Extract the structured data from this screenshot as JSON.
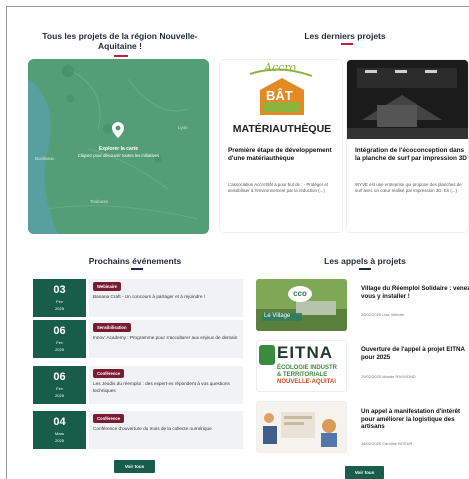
{
  "sections": {
    "projects_map": {
      "title": "Tous les projets de la région Nouvelle-Aquitaine !"
    },
    "latest_projects": {
      "title": "Les derniers projets"
    },
    "events": {
      "title": "Prochains événements"
    },
    "calls": {
      "title": "Les appels à projets"
    }
  },
  "map": {
    "cta_title": "Explorer la carte",
    "cta_subtitle": "Cliquez pour découvrir toutes les initiatives",
    "place_labels": [
      "Bordeaux",
      "Toulouse",
      "Lyon"
    ]
  },
  "projects": [
    {
      "logo_script": "Accro",
      "logo_main": "BÂT",
      "logo_text": "MATÉRIAUTHÈQUE",
      "title": "Première étape de développement d'une matériauthèque",
      "desc": "L'association Accro'Bât a pour but de : - Protéger et sensibiliser à l'environnement par la réduction (...)"
    },
    {
      "title": "Intégration de l'écoconception dans la planche de surf par impression 3D",
      "desc": "WYVE est une entreprise qui propose des planches de surf avec un cœur réalisé par impression 3D. En (...)"
    }
  ],
  "events": [
    {
      "day": "03",
      "month": "Fev",
      "year": "2025",
      "badge": "Webinaire",
      "text": "Banana Craft - Un concours à partager et à rejoindre !"
    },
    {
      "day": "06",
      "month": "Fev",
      "year": "2025",
      "badge": "Sensibilisation",
      "text": "Innov' Academy : Programme pour s'acculturer aux enjeux de demain"
    },
    {
      "day": "06",
      "month": "Fev",
      "year": "2025",
      "badge": "Conférence",
      "text": "Les Jeudis du réemploi : des expert·es répondent à vos questions techniques"
    },
    {
      "day": "04",
      "month": "Mars",
      "year": "2025",
      "badge": "Conférence",
      "text": "Conférence d'ouverture du mois de la collecte numérique"
    }
  ],
  "events_button": "Voir tous",
  "calls": [
    {
      "title": "Village du Réemploi Solidaire : venez vous y installer !",
      "meta": "28/02/2025 Lisa Vetterle",
      "img_logo": "cco",
      "img_caption": "Le Village"
    },
    {
      "title": "Ouverture de l'appel à projet EITNA pour 2025",
      "meta": "29/02/2025 Maude RAYMOND",
      "img_logo": "EITNA",
      "img_sub1": "ÉCOLOGIE INDUSTR",
      "img_sub2": "& TERRITORIALE",
      "img_sub3": "NOUVELLE-AQUITAI"
    },
    {
      "title": "Un appel à manifestation d'intérêt pour améliorer la logistique des artisans",
      "meta": "18/02/2025 Caroline BOSUR"
    }
  ],
  "calls_button": "Voir tous",
  "colors": {
    "accent_green": "#175d4a",
    "badge_red": "#7a1b34",
    "underline_red": "#c41f3b",
    "underline_navy": "#1e2a5a"
  }
}
